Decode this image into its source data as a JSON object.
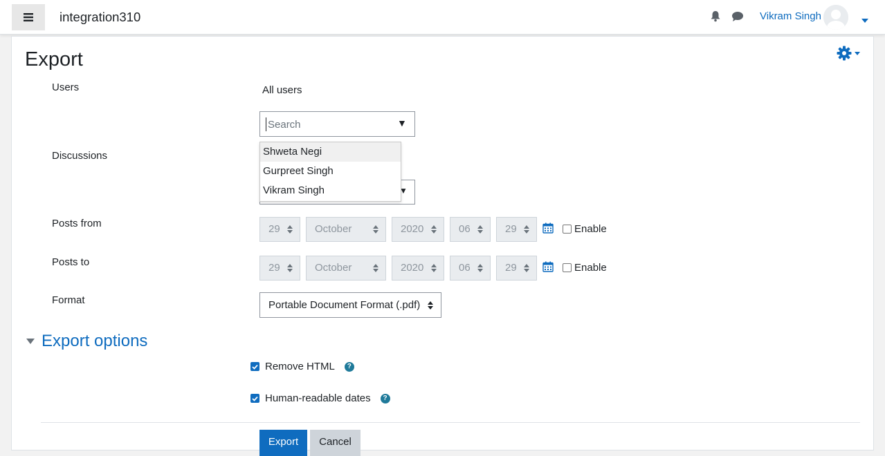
{
  "navbar": {
    "site_name": "integration310",
    "user_name": "Vikram Singh"
  },
  "page": {
    "title": "Export"
  },
  "form": {
    "users_label": "Users",
    "users_static": "All users",
    "search_placeholder": "Search",
    "discussions_label": "Discussions",
    "dropdown_items": [
      "Shweta Negi",
      "Gurpreet Singh",
      "Vikram Singh"
    ],
    "posts_from_label": "Posts from",
    "posts_to_label": "Posts to",
    "date": {
      "day": "29",
      "month": "October",
      "year": "2020",
      "hour": "06",
      "minute": "29"
    },
    "enable_label": "Enable",
    "format_label": "Format",
    "format_value": "Portable Document Format (.pdf)"
  },
  "export_options": {
    "title": "Export options",
    "remove_html": "Remove HTML",
    "human_dates": "Human-readable dates"
  },
  "buttons": {
    "export": "Export",
    "cancel": "Cancel"
  },
  "colors": {
    "accent": "#0f6cbf",
    "help": "#1f7a9a"
  }
}
